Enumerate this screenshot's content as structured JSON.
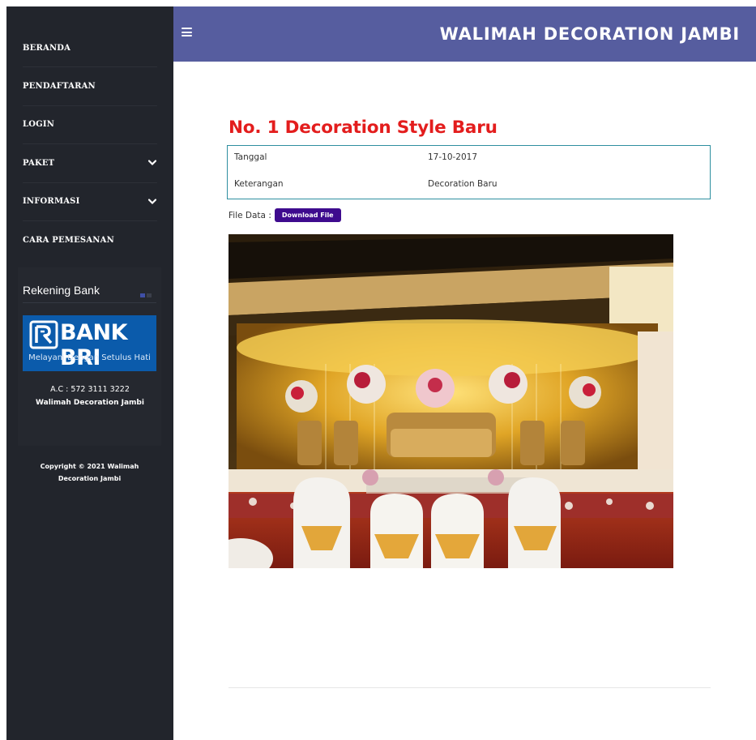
{
  "sidebar": {
    "nav": [
      {
        "label": "BERANDA",
        "has_submenu": false
      },
      {
        "label": "PENDAFTARAN",
        "has_submenu": false
      },
      {
        "label": "LOGIN",
        "has_submenu": false
      },
      {
        "label": "PAKET",
        "has_submenu": true
      },
      {
        "label": "INFORMASI",
        "has_submenu": true
      },
      {
        "label": "CARA PEMESANAN",
        "has_submenu": false
      }
    ],
    "bank_section": {
      "title": "Rekening Bank",
      "logo_text": "BANK BRI",
      "logo_tagline": "Melayani Dengan Setulus Hati",
      "account_number": "A.C : 572 3111 3222",
      "account_name": "Walimah Decoration Jambi"
    },
    "copyright": "Copyright © 2021 Walimah Decoration Jambi"
  },
  "header": {
    "menu_icon": "hamburger-icon",
    "site_title": "WALIMAH DECORATION JAMBI"
  },
  "post": {
    "title": "No. 1 Decoration Style Baru",
    "details": [
      {
        "key": "Tanggal",
        "value": "17-10-2017"
      },
      {
        "key": "Keterangan",
        "value": "Decoration Baru"
      }
    ],
    "file_label": "File Data :",
    "download_label": "Download File"
  },
  "colors": {
    "sidebar_bg": "#22252c",
    "header_bg": "#565d9f",
    "title_red": "#e31d1d",
    "download_button": "#3e0b8e",
    "bri_blue": "#0b5bab"
  }
}
